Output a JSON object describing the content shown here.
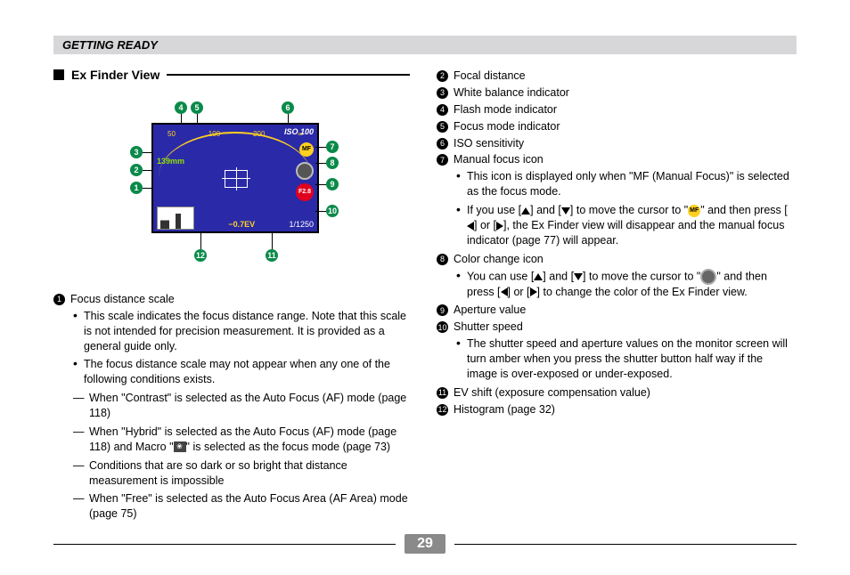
{
  "section_header": "GETTING READY",
  "subtitle": "Ex Finder View",
  "page_number": "29",
  "diagram": {
    "iso_label": "ISO 100",
    "focal_label": "139mm",
    "ev_label": "−0.7EV",
    "shutter_label": "1/1250",
    "aperture_label": "F2.8",
    "mf_label": "MF",
    "arc_numbers": [
      "50",
      "100",
      "200",
      "∞"
    ],
    "callouts": [
      "1",
      "2",
      "3",
      "4",
      "5",
      "6",
      "7",
      "8",
      "9",
      "10",
      "11",
      "12"
    ]
  },
  "left": {
    "item1_title": "Focus distance scale",
    "item1_b1": "This scale indicates the focus distance range. Note that this scale is not intended for precision measurement. It is provided as a general guide only.",
    "item1_b2": "The focus distance scale may not appear when any one of the following conditions exists.",
    "item1_d1": "When \"Contrast\" is selected as the Auto Focus (AF) mode (page 118)",
    "item1_d2_a": "When \"Hybrid\" is selected as the Auto Focus (AF) mode (page 118) and Macro \"",
    "item1_d2_b": "\" is selected as the focus mode (page 73)",
    "item1_d3": "Conditions that are so dark or so bright that distance measurement is impossible",
    "item1_d4": "When \"Free\" is selected as the Auto Focus Area (AF Area) mode (page 75)"
  },
  "right": {
    "i2": "Focal distance",
    "i3": "White balance indicator",
    "i4": "Flash mode indicator",
    "i5": "Focus mode indicator",
    "i6": "ISO sensitivity",
    "i7": "Manual focus icon",
    "i7_b1": "This icon is displayed only when \"MF (Manual Focus)\" is selected as the focus mode.",
    "i7_b2_a": "If you use [",
    "i7_b2_b": "] and [",
    "i7_b2_c": "] to move the cursor to \"",
    "i7_b2_d": "\" and then press [",
    "i7_b2_e": "] or [",
    "i7_b2_f": "], the Ex Finder view will disappear and the manual focus indicator (page 77) will appear.",
    "i8": "Color change icon",
    "i8_b1_a": "You can use [",
    "i8_b1_b": "] and [",
    "i8_b1_c": "] to move the cursor to \"",
    "i8_b1_d": "\" and then press [",
    "i8_b1_e": "] or [",
    "i8_b1_f": "] to change the color of the Ex Finder view.",
    "i9": "Aperture value",
    "i10": "Shutter speed",
    "i10_b1": "The shutter speed and aperture values on the monitor screen will turn amber when you press the shutter button half way if the image is over-exposed or under-exposed.",
    "i11": "EV shift (exposure compensation value)",
    "i12": "Histogram (page 32)"
  },
  "icons": {
    "macro_glyph": "❀"
  }
}
